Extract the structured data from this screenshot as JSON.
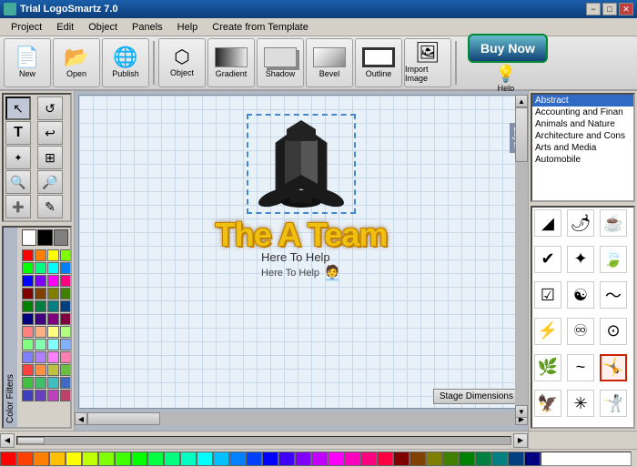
{
  "window": {
    "title": "Trial LogoSmartz 7.0",
    "icon": "logo-icon"
  },
  "title_controls": {
    "minimize": "−",
    "restore": "□",
    "close": "✕"
  },
  "menu": {
    "items": [
      {
        "label": "Project",
        "id": "project"
      },
      {
        "label": "Edit",
        "id": "edit"
      },
      {
        "label": "Object",
        "id": "object"
      },
      {
        "label": "Panels",
        "id": "panels"
      },
      {
        "label": "Help",
        "id": "help"
      },
      {
        "label": "Create from Template",
        "id": "create-from-template"
      }
    ]
  },
  "toolbar": {
    "buttons": [
      {
        "label": "New",
        "id": "new",
        "icon": "📄"
      },
      {
        "label": "Open",
        "id": "open",
        "icon": "📂"
      },
      {
        "label": "Publish",
        "id": "publish",
        "icon": "🌐"
      },
      {
        "label": "Object",
        "id": "object",
        "icon": "⬡"
      },
      {
        "label": "Gradient",
        "id": "gradient",
        "icon": "▭"
      },
      {
        "label": "Shadow",
        "id": "shadow",
        "icon": "▭"
      },
      {
        "label": "Bevel",
        "id": "bevel",
        "icon": "▭"
      },
      {
        "label": "Outline",
        "id": "outline",
        "icon": "▭"
      },
      {
        "label": "Import Image",
        "id": "import-image",
        "icon": "🖼"
      }
    ],
    "buy_now": "Buy Now",
    "help": "Help"
  },
  "left_tools": {
    "tools": [
      {
        "id": "select",
        "icon": "↖",
        "active": true
      },
      {
        "id": "rotate",
        "icon": "↺"
      },
      {
        "id": "text",
        "icon": "T"
      },
      {
        "id": "flip",
        "icon": "↩"
      },
      {
        "id": "effects1",
        "icon": "✦"
      },
      {
        "id": "effects2",
        "icon": "⊞"
      },
      {
        "id": "zoom-in",
        "icon": "🔍"
      },
      {
        "id": "zoom-out",
        "icon": "🔎"
      },
      {
        "id": "add",
        "icon": "➕"
      },
      {
        "id": "pen",
        "icon": "✎"
      }
    ]
  },
  "canvas": {
    "logo_text_main": "The A Team",
    "logo_text_sub": "Here To Help",
    "stage_dimensions_btn": "Stage Dimensions",
    "layer_tab": "Layer"
  },
  "categories": [
    {
      "label": "Abstract",
      "id": "abstract"
    },
    {
      "label": "Accounting and Finan",
      "id": "accounting"
    },
    {
      "label": "Animals and Nature",
      "id": "animals"
    },
    {
      "label": "Architecture and Cons",
      "id": "architecture"
    },
    {
      "label": "Arts and Media",
      "id": "arts"
    },
    {
      "label": "Automobile",
      "id": "automobile"
    }
  ],
  "icon_grid": [
    {
      "symbol": "◢",
      "id": "i1"
    },
    {
      "symbol": "🌶",
      "id": "i2"
    },
    {
      "symbol": "☕",
      "id": "i3"
    },
    {
      "symbol": "✔",
      "id": "i4"
    },
    {
      "symbol": "✦",
      "id": "i5"
    },
    {
      "symbol": "🍃",
      "id": "i6"
    },
    {
      "symbol": "☑",
      "id": "i7"
    },
    {
      "symbol": "☯",
      "id": "i8"
    },
    {
      "symbol": "〜",
      "id": "i9"
    },
    {
      "symbol": "⚡",
      "id": "i10"
    },
    {
      "symbol": "♾",
      "id": "i11"
    },
    {
      "symbol": "⊙",
      "id": "i12"
    },
    {
      "symbol": "🌿",
      "id": "i13"
    },
    {
      "symbol": "~",
      "id": "i14"
    },
    {
      "symbol": "🤸",
      "id": "i15",
      "selected": true
    },
    {
      "symbol": "🦅",
      "id": "i16"
    },
    {
      "symbol": "✳",
      "id": "i17"
    },
    {
      "symbol": "🤺",
      "id": "i18"
    }
  ],
  "color_palette": {
    "top_colors": [
      "#ffffff",
      "#000000",
      "#808080"
    ],
    "swatches": [
      "#ff0000",
      "#ff8000",
      "#ffff00",
      "#80ff00",
      "#00ff00",
      "#00ff80",
      "#00ffff",
      "#0080ff",
      "#0000ff",
      "#8000ff",
      "#ff00ff",
      "#ff0080",
      "#800000",
      "#804000",
      "#808000",
      "#408000",
      "#008000",
      "#008040",
      "#008080",
      "#004080",
      "#000080",
      "#400080",
      "#800080",
      "#800040",
      "#ff8080",
      "#ffb080",
      "#ffff80",
      "#b0ff80",
      "#80ff80",
      "#80ffb0",
      "#80ffff",
      "#80b0ff",
      "#8080ff",
      "#b080ff",
      "#ff80ff",
      "#ff80b0",
      "#ff4040",
      "#ff9040",
      "#bfbf40",
      "#6abf40",
      "#40bf40",
      "#40bf6a",
      "#40bfbf",
      "#406abf",
      "#4040bf",
      "#6a40bf",
      "#bf40bf",
      "#bf406a"
    ]
  },
  "bottom_color_bar": {
    "colors": [
      "#ff0000",
      "#ff4000",
      "#ff8000",
      "#ffc000",
      "#ffff00",
      "#c0ff00",
      "#80ff00",
      "#40ff00",
      "#00ff00",
      "#00ff40",
      "#00ff80",
      "#00ffc0",
      "#00ffff",
      "#00c0ff",
      "#0080ff",
      "#0040ff",
      "#0000ff",
      "#4000ff",
      "#8000ff",
      "#c000ff",
      "#ff00ff",
      "#ff00c0",
      "#ff0080",
      "#ff0040",
      "#800000",
      "#804000",
      "#808000",
      "#408000",
      "#008000",
      "#008040",
      "#008080",
      "#004080",
      "#000080"
    ]
  },
  "scroll": {
    "left_arrow": "◀",
    "right_arrow": "▶",
    "up_arrow": "▲",
    "down_arrow": "▼"
  }
}
